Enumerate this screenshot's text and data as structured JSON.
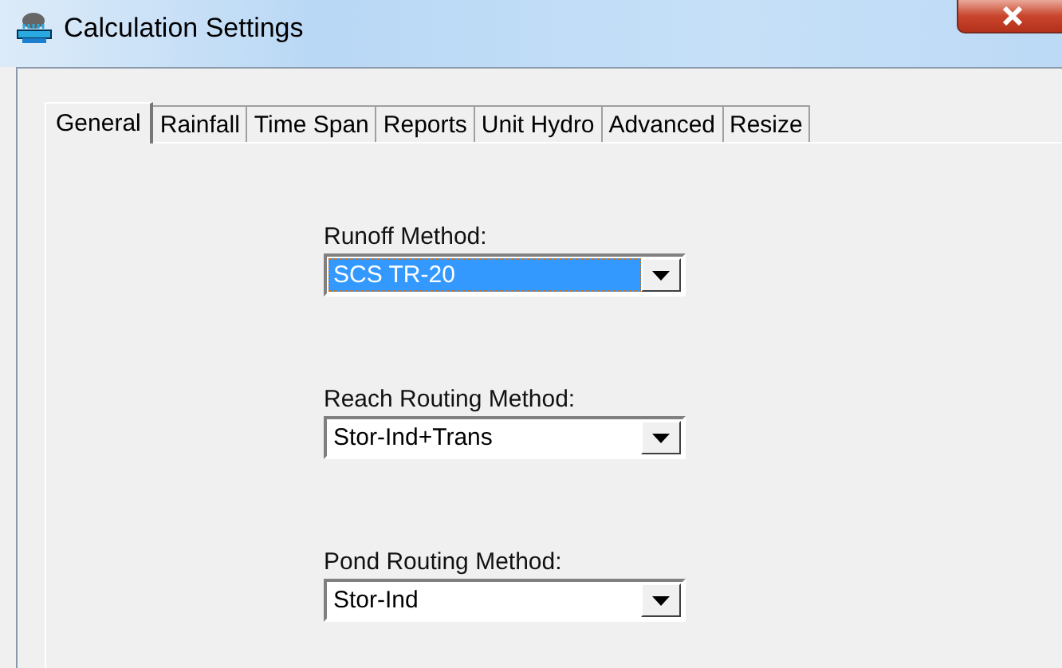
{
  "window": {
    "title": "Calculation Settings"
  },
  "tabs": [
    {
      "label": "General",
      "selected": true
    },
    {
      "label": "Rainfall",
      "selected": false
    },
    {
      "label": "Time Span",
      "selected": false
    },
    {
      "label": "Reports",
      "selected": false
    },
    {
      "label": "Unit Hydro",
      "selected": false
    },
    {
      "label": "Advanced",
      "selected": false
    },
    {
      "label": "Resize",
      "selected": false
    }
  ],
  "fields": [
    {
      "label": "Runoff Method:",
      "value": "SCS TR-20",
      "focused": true
    },
    {
      "label": "Reach Routing Method:",
      "value": "Stor-Ind+Trans",
      "focused": false
    },
    {
      "label": "Pond Routing Method:",
      "value": "Stor-Ind",
      "focused": false
    }
  ]
}
